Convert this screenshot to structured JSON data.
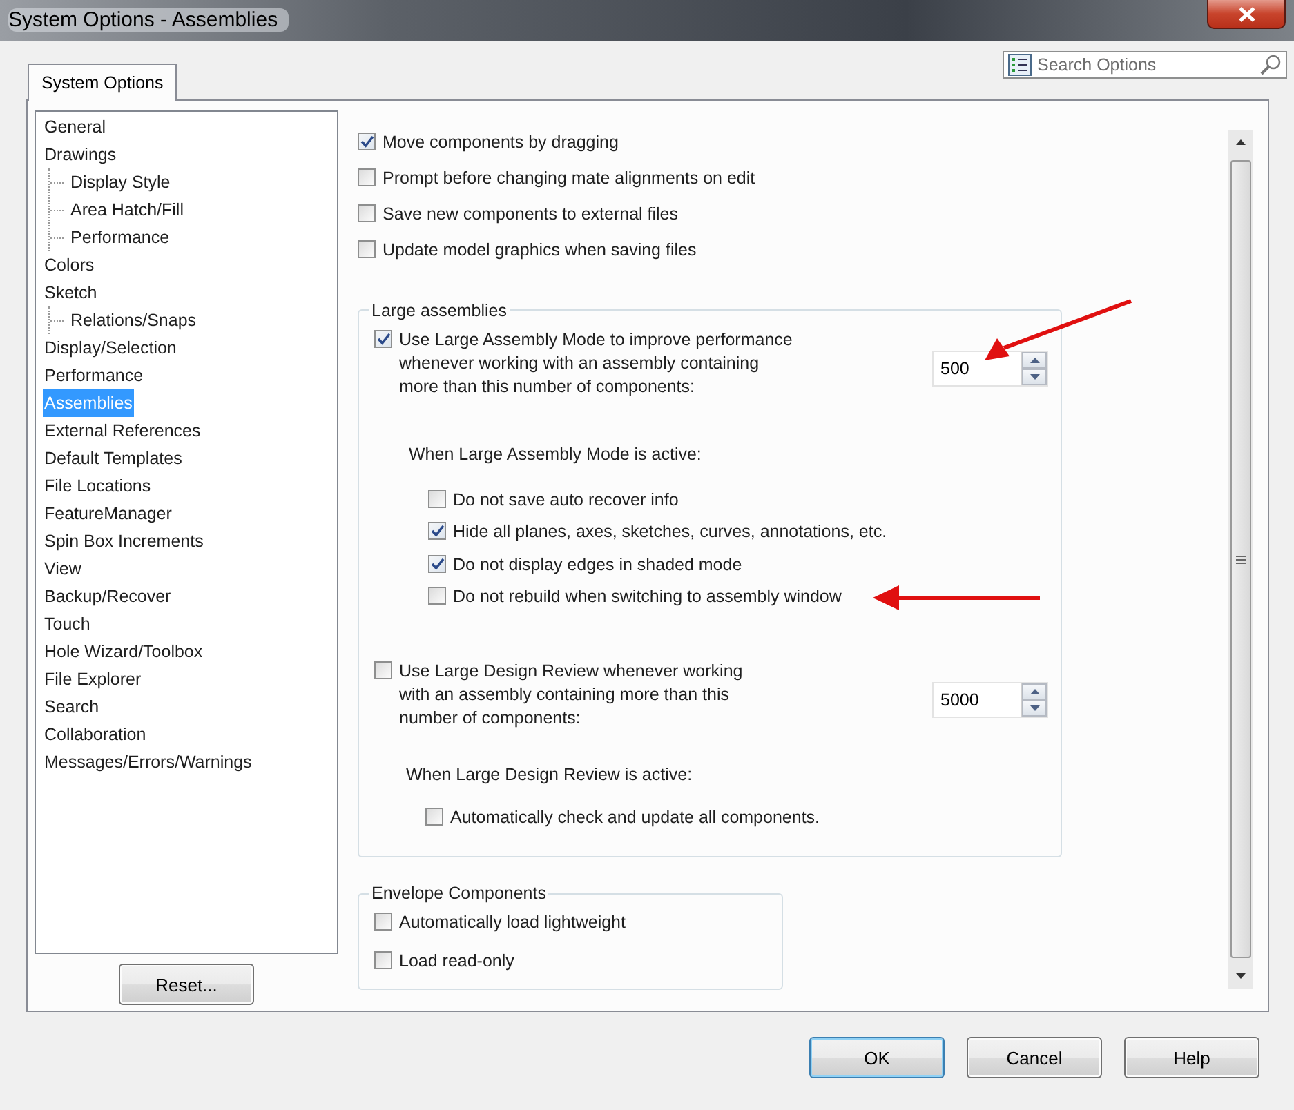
{
  "window": {
    "title": "System Options - Assemblies"
  },
  "tabs": [
    {
      "label": "System Options",
      "selected": true
    }
  ],
  "search": {
    "placeholder": "Search Options"
  },
  "tree": [
    {
      "label": "General",
      "selected": false
    },
    {
      "label": "Drawings",
      "selected": false,
      "children": [
        {
          "label": "Display Style",
          "selected": false
        },
        {
          "label": "Area Hatch/Fill",
          "selected": false
        },
        {
          "label": "Performance",
          "selected": false
        }
      ]
    },
    {
      "label": "Colors",
      "selected": false
    },
    {
      "label": "Sketch",
      "selected": false,
      "children": [
        {
          "label": "Relations/Snaps",
          "selected": false
        }
      ]
    },
    {
      "label": "Display/Selection",
      "selected": false
    },
    {
      "label": "Performance",
      "selected": false
    },
    {
      "label": "Assemblies",
      "selected": true
    },
    {
      "label": "External References",
      "selected": false
    },
    {
      "label": "Default Templates",
      "selected": false
    },
    {
      "label": "File Locations",
      "selected": false
    },
    {
      "label": "FeatureManager",
      "selected": false
    },
    {
      "label": "Spin Box Increments",
      "selected": false
    },
    {
      "label": "View",
      "selected": false
    },
    {
      "label": "Backup/Recover",
      "selected": false
    },
    {
      "label": "Touch",
      "selected": false
    },
    {
      "label": "Hole Wizard/Toolbox",
      "selected": false
    },
    {
      "label": "File Explorer",
      "selected": false
    },
    {
      "label": "Search",
      "selected": false
    },
    {
      "label": "Collaboration",
      "selected": false
    },
    {
      "label": "Messages/Errors/Warnings",
      "selected": false
    }
  ],
  "reset_button": "Reset...",
  "general_options": [
    {
      "label": "Move components by dragging",
      "checked": true
    },
    {
      "label": "Prompt before changing mate alignments on edit",
      "checked": false
    },
    {
      "label": "Save new components to external files",
      "checked": false
    },
    {
      "label": "Update model graphics when saving files",
      "checked": false
    }
  ],
  "large_assemblies": {
    "title": "Large assemblies",
    "mode": {
      "label": "Use Large Assembly Mode to improve performance whenever working with an assembly containing more than this number of components:",
      "checked": true,
      "value": "500"
    },
    "subheading": "When Large Assembly Mode is active:",
    "options": [
      {
        "label": "Do not save auto recover info",
        "checked": false
      },
      {
        "label": "Hide all planes, axes, sketches, curves, annotations, etc.",
        "checked": true
      },
      {
        "label": "Do not display edges in shaded mode",
        "checked": true
      },
      {
        "label": "Do not rebuild when switching to assembly window",
        "checked": false
      }
    ],
    "design_review": {
      "label": "Use Large Design Review whenever working with an assembly containing more than this number of components:",
      "checked": false,
      "value": "5000"
    },
    "design_review_subheading": "When Large Design Review is active:",
    "design_review_options": [
      {
        "label": "Automatically check and update all components.",
        "checked": false
      }
    ]
  },
  "envelope_components": {
    "title": "Envelope Components",
    "options": [
      {
        "label": "Automatically load lightweight",
        "checked": false
      },
      {
        "label": "Load read-only",
        "checked": false
      }
    ]
  },
  "buttons": [
    {
      "label": "OK",
      "default": true
    },
    {
      "label": "Cancel",
      "default": false
    },
    {
      "label": "Help",
      "default": false
    }
  ]
}
